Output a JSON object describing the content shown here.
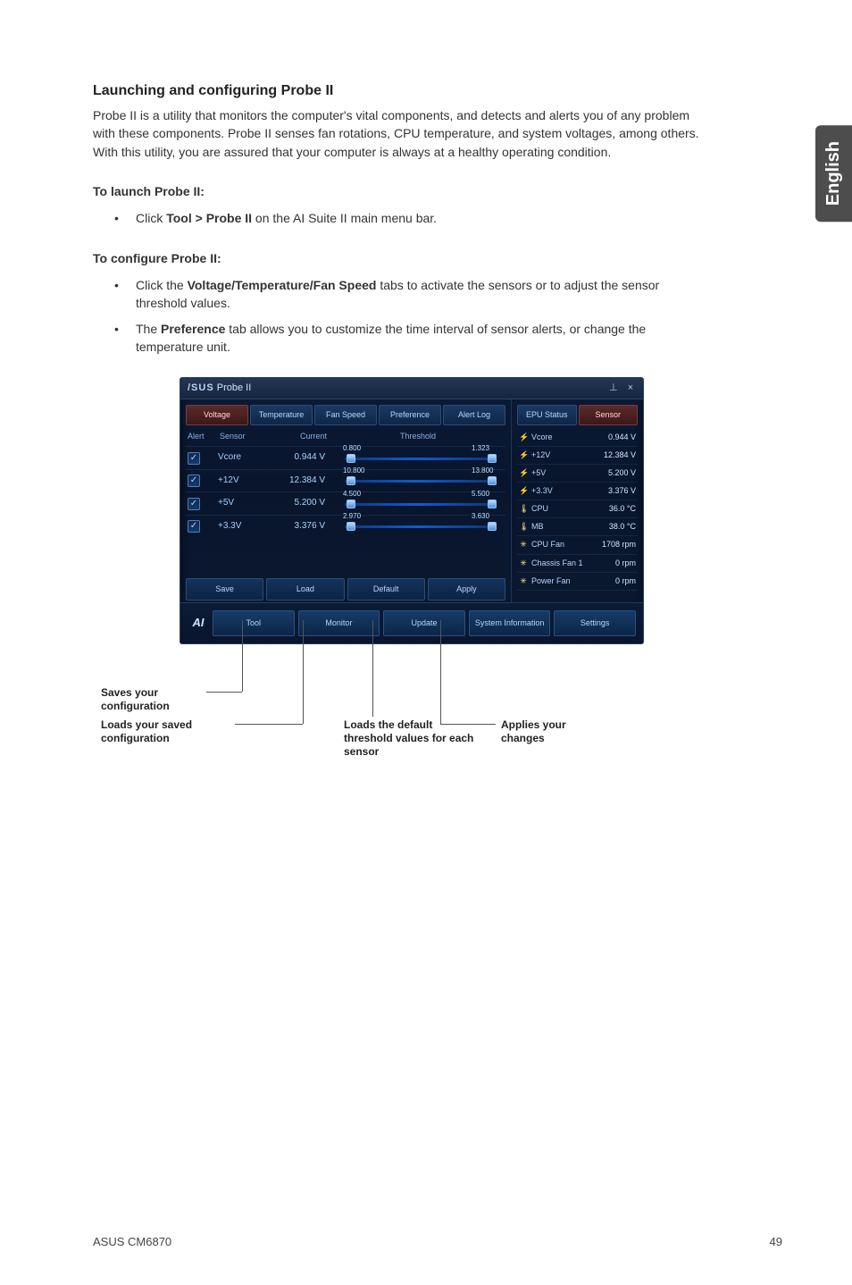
{
  "page": {
    "side_label": "English",
    "heading": "Launching and configuring Probe II",
    "intro": "Probe II is a utility that monitors the computer's vital components, and detects and alerts you of any problem with these components. Probe II senses fan rotations, CPU temperature, and system voltages, among others. With this utility, you are assured that your computer is always at a healthy operating condition.",
    "launch_head": "To launch Probe II:",
    "launch_item_pre": "Click ",
    "launch_item_bold": "Tool > Probe II",
    "launch_item_post": " on the AI Suite II main menu bar.",
    "config_head": "To configure Probe II:",
    "config_item1_pre": "Click the ",
    "config_item1_bold": "Voltage/Temperature/Fan Speed",
    "config_item1_post": " tabs to activate the sensors or to adjust the sensor threshold values.",
    "config_item2_pre": "The ",
    "config_item2_bold": "Preference",
    "config_item2_post": " tab allows you to customize the time interval of sensor alerts, or change the temperature unit."
  },
  "shot": {
    "title_brand": "/SUS",
    "title_app": "Probe II",
    "icons": {
      "pin": "⊥",
      "close": "×"
    },
    "left_tabs": [
      "Voltage",
      "Temperature",
      "Fan Speed",
      "Preference",
      "Alert Log"
    ],
    "left_active": 0,
    "headers": {
      "alert": "Alert",
      "sensor": "Sensor",
      "current": "Current",
      "threshold": "Threshold"
    },
    "rows": [
      {
        "name": "Vcore",
        "current": "0.944 V",
        "lo_lab": "0.800",
        "hi_lab": "1.323",
        "lo": 18,
        "hi": 176
      },
      {
        "name": "+12V",
        "current": "12.384 V",
        "lo_lab": "10.800",
        "hi_lab": "13.800",
        "lo": 18,
        "hi": 176
      },
      {
        "name": "+5V",
        "current": "5.200 V",
        "lo_lab": "4.500",
        "hi_lab": "5.500",
        "lo": 18,
        "hi": 176
      },
      {
        "name": "+3.3V",
        "current": "3.376 V",
        "lo_lab": "2.970",
        "hi_lab": "3.630",
        "lo": 18,
        "hi": 176
      }
    ],
    "bottom_buttons": [
      "Save",
      "Load",
      "Default",
      "Apply"
    ],
    "right_tabs": [
      "EPU Status",
      "Sensor"
    ],
    "right_active": 1,
    "right_items": [
      {
        "icon": "⚡",
        "name": "Vcore",
        "val": "0.944 V"
      },
      {
        "icon": "⚡",
        "name": "+12V",
        "val": "12.384 V"
      },
      {
        "icon": "⚡",
        "name": "+5V",
        "val": "5.200 V"
      },
      {
        "icon": "⚡",
        "name": "+3.3V",
        "val": "3.376 V"
      },
      {
        "icon": "🌡",
        "name": "CPU",
        "val": "36.0 °C"
      },
      {
        "icon": "🌡",
        "name": "MB",
        "val": "38.0 °C"
      },
      {
        "icon": "✳",
        "name": "CPU Fan",
        "val": "1708 rpm"
      },
      {
        "icon": "✳",
        "name": "Chassis Fan 1",
        "val": "0 rpm"
      },
      {
        "icon": "✳",
        "name": "Power Fan",
        "val": "0 rpm"
      }
    ],
    "app_bottom": [
      "Tool",
      "Monitor",
      "Update",
      "System Information",
      "Settings"
    ]
  },
  "callouts": {
    "save": "Saves your configuration",
    "load": "Loads your saved configuration",
    "default": "Loads the default threshold values for each sensor",
    "apply": "Applies your changes"
  },
  "footer": {
    "left": "ASUS CM6870",
    "right": "49"
  }
}
